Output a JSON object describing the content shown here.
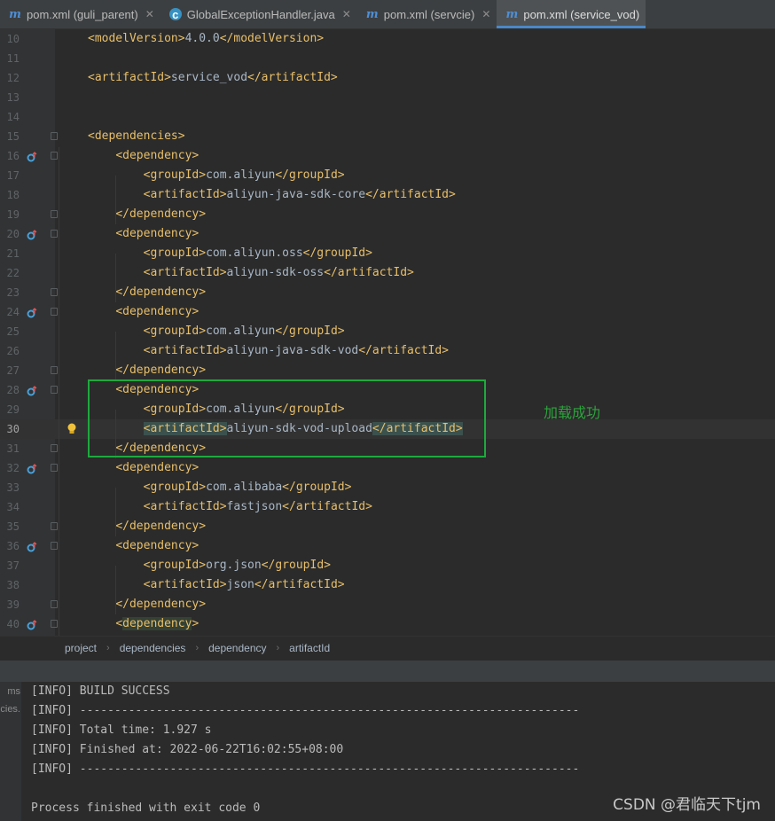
{
  "tabs": [
    {
      "label": "pom.xml (guli_parent)",
      "icon": "maven-icon",
      "close": "✕",
      "active": false
    },
    {
      "label": "GlobalExceptionHandler.java",
      "icon": "java-class-icon",
      "close": "✕",
      "active": false
    },
    {
      "label": "pom.xml (servcie)",
      "icon": "maven-icon",
      "close": "✕",
      "active": false
    },
    {
      "label": "pom.xml (service_vod)",
      "icon": "maven-icon",
      "close": "",
      "active": true
    }
  ],
  "editor": {
    "lines": [
      {
        "n": "10",
        "code": "<modelVersion>4.0.0</modelVersion>"
      },
      {
        "n": "11",
        "code": ""
      },
      {
        "n": "12",
        "code": "<artifactId>service_vod</artifactId>"
      },
      {
        "n": "13",
        "code": ""
      },
      {
        "n": "14",
        "code": ""
      },
      {
        "n": "15",
        "code": "<dependencies>"
      },
      {
        "n": "16",
        "code": "    <dependency>"
      },
      {
        "n": "17",
        "code": "        <groupId>com.aliyun</groupId>"
      },
      {
        "n": "18",
        "code": "        <artifactId>aliyun-java-sdk-core</artifactId>"
      },
      {
        "n": "19",
        "code": "    </dependency>"
      },
      {
        "n": "20",
        "code": "    <dependency>"
      },
      {
        "n": "21",
        "code": "        <groupId>com.aliyun.oss</groupId>"
      },
      {
        "n": "22",
        "code": "        <artifactId>aliyun-sdk-oss</artifactId>"
      },
      {
        "n": "23",
        "code": "    </dependency>"
      },
      {
        "n": "24",
        "code": "    <dependency>"
      },
      {
        "n": "25",
        "code": "        <groupId>com.aliyun</groupId>"
      },
      {
        "n": "26",
        "code": "        <artifactId>aliyun-java-sdk-vod</artifactId>"
      },
      {
        "n": "27",
        "code": "    </dependency>"
      },
      {
        "n": "28",
        "code": "    <dependency>"
      },
      {
        "n": "29",
        "code": "        <groupId>com.aliyun</groupId>"
      },
      {
        "n": "30",
        "code": "        <artifactId>aliyun-sdk-vod-upload</artifactId>"
      },
      {
        "n": "31",
        "code": "    </dependency>"
      },
      {
        "n": "32",
        "code": "    <dependency>"
      },
      {
        "n": "33",
        "code": "        <groupId>com.alibaba</groupId>"
      },
      {
        "n": "34",
        "code": "        <artifactId>fastjson</artifactId>"
      },
      {
        "n": "35",
        "code": "    </dependency>"
      },
      {
        "n": "36",
        "code": "    <dependency>"
      },
      {
        "n": "37",
        "code": "        <groupId>org.json</groupId>"
      },
      {
        "n": "38",
        "code": "        <artifactId>json</artifactId>"
      },
      {
        "n": "39",
        "code": "    </dependency>"
      },
      {
        "n": "40",
        "code": "    <dependency>"
      }
    ],
    "current_line": "30",
    "gutter_marks": [
      "16",
      "20",
      "24",
      "28",
      "32",
      "36",
      "40"
    ],
    "annotation": "加载成功"
  },
  "breadcrumb": [
    "project",
    "dependencies",
    "dependency",
    "artifactId"
  ],
  "console": {
    "side_labels": [
      "ms",
      "cies."
    ],
    "lines": [
      "[INFO] BUILD SUCCESS",
      "[INFO] ------------------------------------------------------------------------",
      "[INFO] Total time: 1.927 s",
      "[INFO] Finished at: 2022-06-22T16:02:55+08:00",
      "[INFO] ------------------------------------------------------------------------",
      "",
      "Process finished with exit code 0"
    ]
  },
  "watermark": "CSDN @君临天下tjm",
  "colors": {
    "tag": "#e8bf6a",
    "text": "#a9b7c6",
    "accent": "#4a88c7",
    "annotation": "#2ca33c"
  }
}
